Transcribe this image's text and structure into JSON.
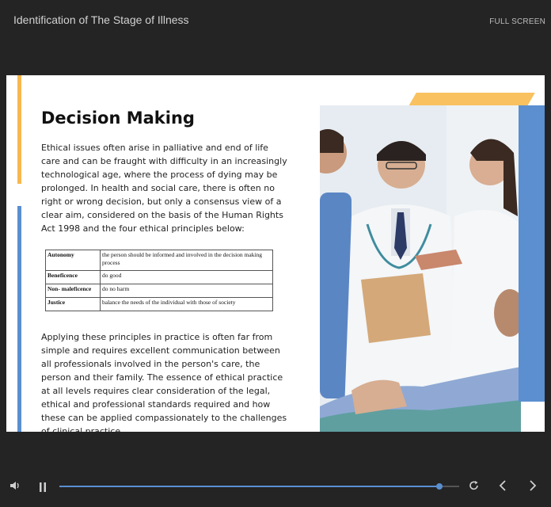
{
  "topbar": {
    "title": "Identification of The Stage of Illness",
    "fullscreen_label": "FULL SCREEN"
  },
  "slide": {
    "title": "Decision Making",
    "paragraph1": "Ethical issues often arise in palliative and end of life care and can be fraught with difficulty in an increasingly technological age, where the process of dying may be prolonged. In health and social care, there is often no right or wrong decision, but only a consensus view of a clear aim, considered on the basis of the Human Rights Act 1998 and the four ethical principles below:",
    "principles": [
      {
        "name": "Autonomy",
        "description": "the person should be informed and involved in the decision making process"
      },
      {
        "name": "Beneficence",
        "description": "do good"
      },
      {
        "name": "Non- maleficence",
        "description": "do no harm"
      },
      {
        "name": "Justice",
        "description": "balance the needs of the individual with those of society"
      }
    ],
    "paragraph2": "Applying these principles in practice is often far from simple and requires excellent communication between all professionals involved in the person's care, the person and their family. The essence of ethical practice at all levels requires clear consideration of the legal, ethical and professional standards required and how these can be applied compassionately to the challenges of clinical practice.",
    "colors": {
      "orange_accent": "#f7b84f",
      "blue_accent": "#5a8fd0"
    }
  },
  "player": {
    "progress": 0.95,
    "icons": [
      "volume-icon",
      "pause-icon",
      "replay-icon",
      "chevron-left-icon",
      "chevron-right-icon"
    ]
  }
}
